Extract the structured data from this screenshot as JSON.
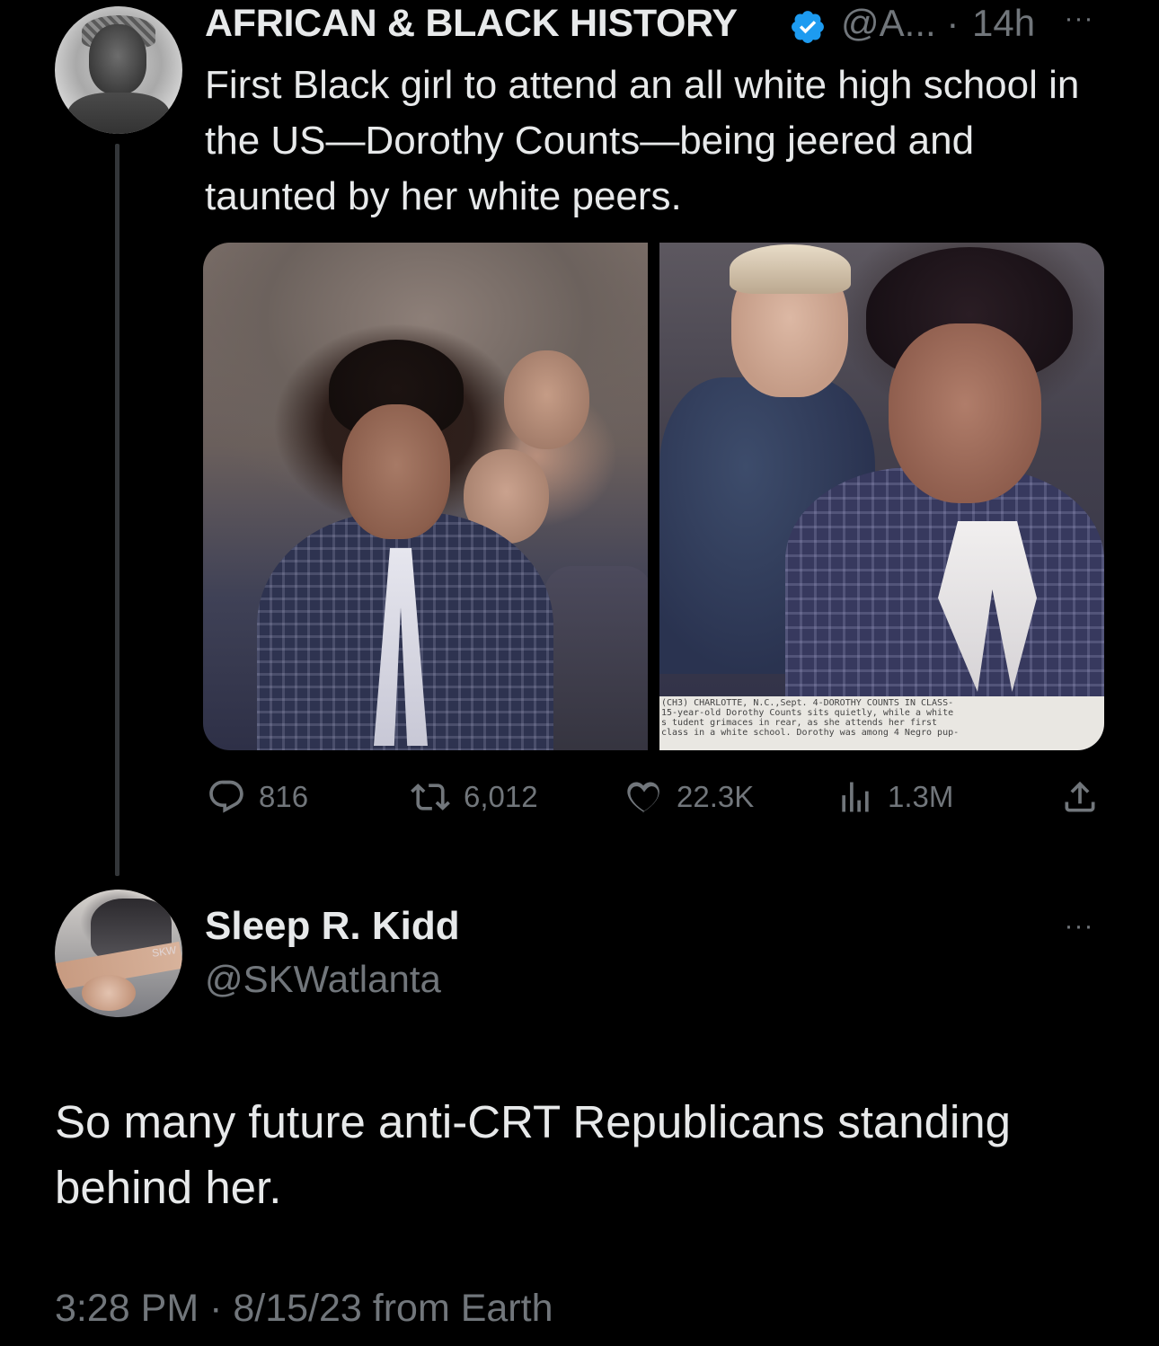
{
  "parent_tweet": {
    "author_name": "AFRICAN & BLACK HISTORY",
    "handle": "@A...",
    "separator": "·",
    "time": "14h",
    "more_label": "···",
    "text": "First Black girl to attend an all white high school in the US—Dorothy Counts—being jeered and taunted by her white peers.",
    "media_caption": "(CH3) CHARLOTTE, N.C.,Sept. 4-DOROTHY COUNTS IN CLASS-\n15-year-old Dorothy Counts sits quietly, while a white\ns tudent grimaces in rear, as she attends her first\nclass in a white school. Dorothy was among 4 Negro pup-",
    "actions": {
      "replies": "816",
      "retweets": "6,012",
      "likes": "22.3K",
      "views": "1.3M"
    },
    "icons": {
      "verified": "verified-badge-icon",
      "reply": "reply-icon",
      "retweet": "retweet-icon",
      "like": "heart-icon",
      "views": "views-icon",
      "share": "share-icon"
    }
  },
  "reply_tweet": {
    "author_name": "Sleep R. Kidd",
    "handle": "@SKWatlanta",
    "more_label": "···",
    "avatar_tag": "SKW",
    "text": "So many future anti-CRT Republicans standing behind her.",
    "meta": "3:28 PM · 8/15/23 from Earth"
  },
  "colors": {
    "background": "#000000",
    "text_primary": "#e7e9ea",
    "text_secondary": "#71767b",
    "verified_blue": "#1d9bf0",
    "thread_line": "#333639"
  }
}
